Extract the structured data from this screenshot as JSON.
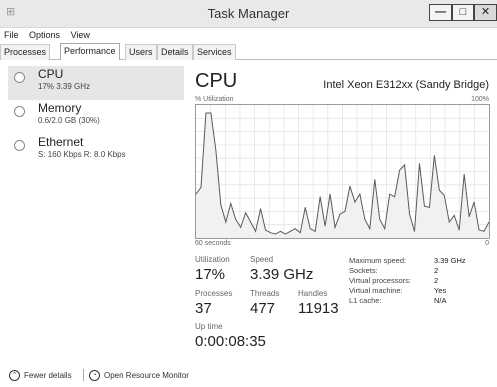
{
  "window": {
    "title": "Task Manager",
    "min_glyph": "—",
    "max_glyph": "□",
    "close_glyph": "✕"
  },
  "menu": [
    "File",
    "Options",
    "View"
  ],
  "tabs": [
    "Processes",
    "Performance",
    "Users",
    "Details",
    "Services"
  ],
  "active_tab": "Performance",
  "sidebar": {
    "items": [
      {
        "name": "CPU",
        "sub": "17% 3.39 GHz"
      },
      {
        "name": "Memory",
        "sub": "0.6/2.0 GB (30%)"
      },
      {
        "name": "Ethernet",
        "sub": "S: 160 Kbps R: 8.0 Kbps"
      }
    ]
  },
  "main": {
    "title": "CPU",
    "model": "Intel Xeon E312xx (Sandy Bridge)",
    "axis_top_left": "% Utilization",
    "axis_top_right": "100%",
    "axis_bottom_left": "60 seconds",
    "axis_bottom_right": "0"
  },
  "chart_data": {
    "type": "line",
    "ylim": [
      0,
      100
    ],
    "xlabel": "60 seconds",
    "ylabel": "% Utilization",
    "grid": true,
    "values": [
      33,
      38,
      94,
      94,
      66,
      25,
      12,
      26,
      14,
      8,
      19,
      12,
      5,
      22,
      6,
      4,
      3,
      5,
      3,
      5,
      7,
      4,
      23,
      7,
      5,
      31,
      9,
      33,
      8,
      18,
      20,
      39,
      27,
      33,
      14,
      7,
      44,
      14,
      7,
      33,
      31,
      51,
      55,
      18,
      5,
      56,
      24,
      23,
      62,
      36,
      32,
      12,
      17,
      6,
      48,
      16,
      27,
      6,
      5,
      12
    ]
  },
  "stats": {
    "utilization_label": "Utilization",
    "utilization_value": "17%",
    "speed_label": "Speed",
    "speed_value": "3.39 GHz",
    "processes_label": "Processes",
    "processes_value": "37",
    "threads_label": "Threads",
    "threads_value": "477",
    "handles_label": "Handles",
    "handles_value": "11913",
    "uptime_label": "Up time",
    "uptime_value": "0:00:08:35"
  },
  "specs": [
    {
      "label": "Maximum speed:",
      "value": "3.39 GHz"
    },
    {
      "label": "Sockets:",
      "value": "2"
    },
    {
      "label": "Virtual processors:",
      "value": "2"
    },
    {
      "label": "Virtual machine:",
      "value": "Yes"
    },
    {
      "label": "L1 cache:",
      "value": "N/A"
    }
  ],
  "footer": {
    "fewer_details": "Fewer details",
    "open_resource_monitor": "Open Resource Monitor"
  }
}
